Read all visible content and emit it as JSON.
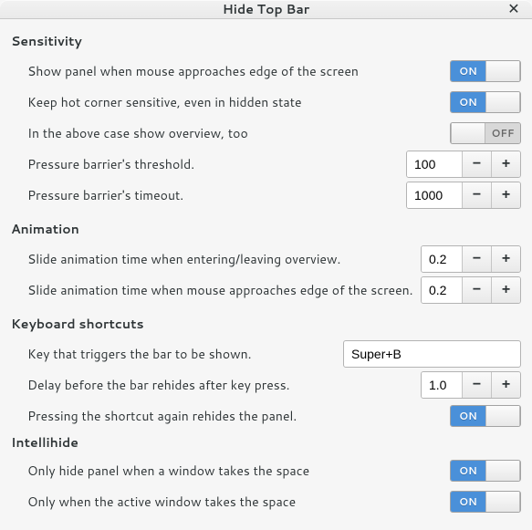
{
  "title": "Hide Top Bar",
  "sections": {
    "sensitivity": {
      "header": "Sensitivity",
      "show_panel_edge": {
        "label": "Show panel when mouse approaches edge of the screen",
        "value": "ON"
      },
      "hot_corner": {
        "label": "Keep hot corner sensitive, even in hidden state",
        "value": "ON"
      },
      "overview_too": {
        "label": "In the above case show overview, too",
        "value": "OFF"
      },
      "threshold": {
        "label": "Pressure barrier's threshold.",
        "value": "100"
      },
      "timeout": {
        "label": "Pressure barrier's timeout.",
        "value": "1000"
      }
    },
    "animation": {
      "header": "Animation",
      "slide_overview": {
        "label": "Slide animation time when entering/leaving overview.",
        "value": "0.2"
      },
      "slide_edge": {
        "label": "Slide animation time when mouse approaches edge of the screen.",
        "value": "0.2"
      }
    },
    "keyboard": {
      "header": "Keyboard shortcuts",
      "trigger_key": {
        "label": "Key that triggers the bar to be shown.",
        "value": "Super+B"
      },
      "rehide_delay": {
        "label": "Delay before the bar rehides after key press.",
        "value": "1.0"
      },
      "shortcut_rehides": {
        "label": "Pressing the shortcut again rehides the panel.",
        "value": "ON"
      }
    },
    "intellihide": {
      "header": "Intellihide",
      "window_space": {
        "label": "Only hide panel when a window takes the space",
        "value": "ON"
      },
      "active_window": {
        "label": "Only when the active window takes the space",
        "value": "ON"
      }
    }
  },
  "switch_text": {
    "on": "ON",
    "off": "OFF"
  },
  "buttons": {
    "minus": "−",
    "plus": "+"
  }
}
